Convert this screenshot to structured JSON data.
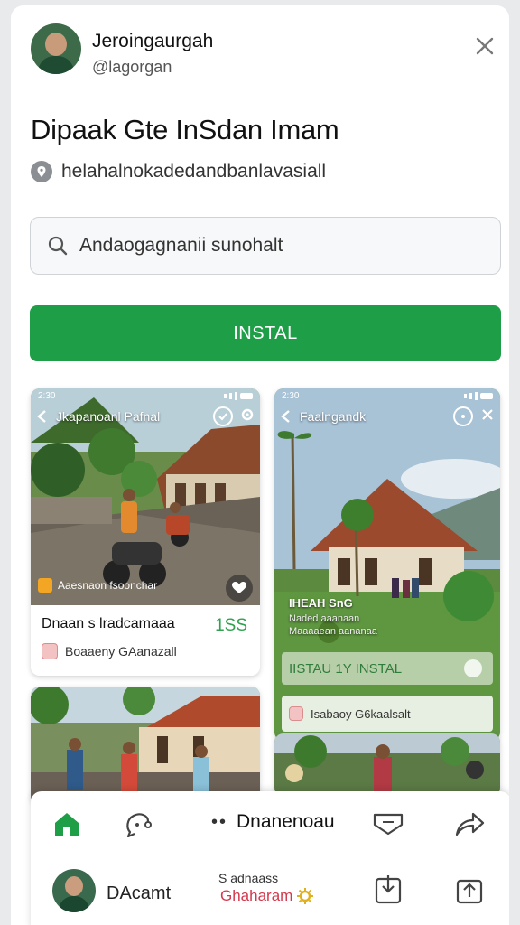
{
  "profile": {
    "name": "Jeroingaurgah",
    "handle": "@lagorgan"
  },
  "listing": {
    "title": "Dipaak Gte InSdan Imam",
    "location": "helahalnokadedandbanlavasiall"
  },
  "search": {
    "value": "Andaogagnanii sunohalt"
  },
  "actions": {
    "install_label": "INSTAL"
  },
  "screenshots": [
    {
      "status_time": "2:30",
      "nav_title": "Jkapanoanl Pafnal",
      "caption_badge": "Aaesnaon fsoonchar",
      "footer_title": "Dnaan s lradcamaaa",
      "footer_number": "1SS",
      "footer_sub": "Boaaeny GAanazall"
    },
    {
      "status_time": "2:30",
      "nav_title": "Faalngandk",
      "overlay_title": "IHEAH SnG",
      "overlay_sub": "Naded aaanaan Maaaaean aananaa",
      "install_strip": "IISTAU 1Y INSTAL",
      "footer_sub": "Isabaoy G6kaalsalt"
    }
  ],
  "bottom_bar": {
    "center_label": "Dnanenoau",
    "center_dots": "••",
    "user_name": "DAcamt",
    "status_line1": "S adnaass",
    "status_line2": "Ghaharam"
  },
  "colors": {
    "accent_green": "#1e9e46",
    "number_green": "#2fa14f",
    "status_red": "#d4384d"
  },
  "icons": [
    "close-icon",
    "location-icon",
    "search-icon",
    "home-icon",
    "chat-icon",
    "tag-icon",
    "share-icon",
    "heart-icon",
    "badge-icon",
    "gear-icon",
    "download-icon",
    "save-icon"
  ]
}
